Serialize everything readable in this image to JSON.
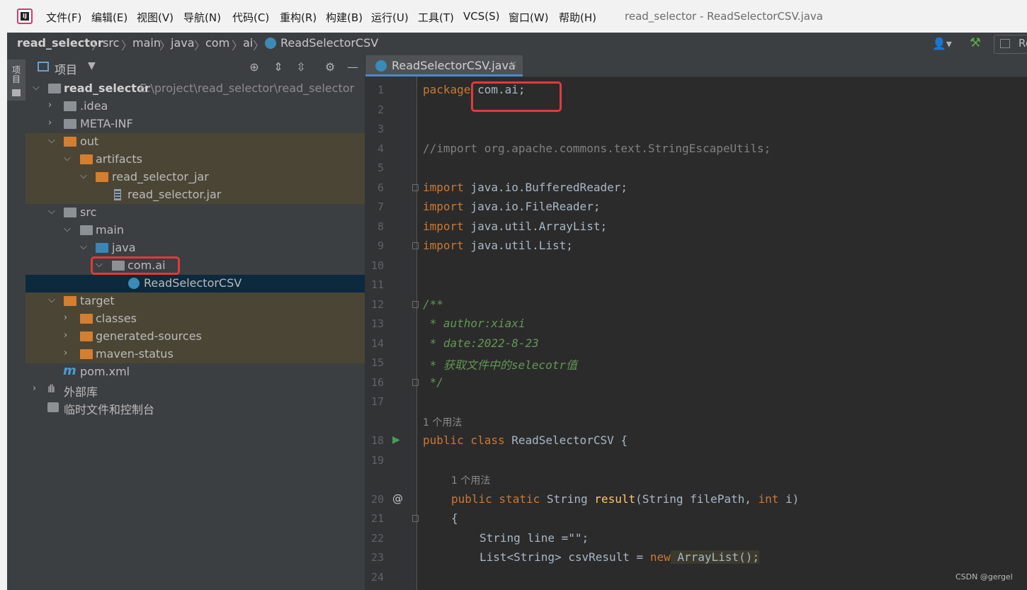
{
  "menu": {
    "items": [
      "文件(F)",
      "编辑(E)",
      "视图(V)",
      "导航(N)",
      "代码(C)",
      "重构(R)",
      "构建(B)",
      "运行(U)",
      "工具(T)",
      "VCS(S)",
      "窗口(W)",
      "帮助(H)"
    ],
    "window_title": "read_selector - ReadSelectorCSV.java"
  },
  "breadcrumb": [
    "read_selector",
    "src",
    "main",
    "java",
    "com",
    "ai",
    "ReadSelectorCSV"
  ],
  "toolbar": {
    "run_config_label": "Re"
  },
  "tool_window": {
    "vertical_label": "项目"
  },
  "project_panel": {
    "title": "项目",
    "tree": [
      {
        "label": "read_selector",
        "path": "E:\\project\\read_selector\\read_selector",
        "icon": "module-folder-icon"
      },
      {
        "label": ".idea",
        "icon": "folder-icon"
      },
      {
        "label": "META-INF",
        "icon": "folder-icon"
      },
      {
        "label": "out",
        "icon": "excluded-folder-icon"
      },
      {
        "label": "artifacts",
        "icon": "excluded-folder-icon"
      },
      {
        "label": "read_selector_jar",
        "icon": "excluded-folder-icon"
      },
      {
        "label": "read_selector.jar",
        "icon": "jar-file-icon"
      },
      {
        "label": "src",
        "icon": "folder-icon"
      },
      {
        "label": "main",
        "icon": "folder-icon"
      },
      {
        "label": "java",
        "icon": "source-root-icon"
      },
      {
        "label": "com.ai",
        "icon": "package-icon"
      },
      {
        "label": "ReadSelectorCSV",
        "icon": "java-class-icon"
      },
      {
        "label": "target",
        "icon": "excluded-folder-icon"
      },
      {
        "label": "classes",
        "icon": "excluded-folder-icon"
      },
      {
        "label": "generated-sources",
        "icon": "excluded-folder-icon"
      },
      {
        "label": "maven-status",
        "icon": "excluded-folder-icon"
      },
      {
        "label": "pom.xml",
        "icon": "maven-icon"
      },
      {
        "label": "外部库",
        "icon": "library-icon"
      },
      {
        "label": "临时文件和控制台",
        "icon": "scratches-icon"
      }
    ]
  },
  "editor": {
    "tab_label": "ReadSelectorCSV.java",
    "line_numbers": [
      "1",
      "2",
      "3",
      "4",
      "5",
      "6",
      "7",
      "8",
      "9",
      "10",
      "11",
      "12",
      "13",
      "14",
      "15",
      "16",
      "17",
      "18",
      "19",
      "20",
      "21",
      "22",
      "23",
      "24"
    ],
    "code": {
      "l1_kw": "package",
      "l1_rest": " com.ai;",
      "l4": "//import org.apache.commons.text.StringEscapeUtils;",
      "l6_kw": "import",
      "l6_rest": " java.io.BufferedReader;",
      "l7_kw": "import",
      "l7_rest": " java.io.FileReader;",
      "l8_kw": "import",
      "l8_rest": " java.util.ArrayList;",
      "l9_kw": "import",
      "l9_rest": " java.util.List;",
      "l12": "/**",
      "l13": " * author:xiaxi",
      "l14": " * date:2022-8-23",
      "l15": " * 获取文件中的selecotr值",
      "l16": " */",
      "hint1": "1 个用法",
      "l18_kw": "public class",
      "l18_rest": " ReadSelectorCSV {",
      "hint2": "1 个用法",
      "l20_kw": "public static",
      "l20_type": " String ",
      "l20_fn": "result",
      "l20_p1": "(String filePath, ",
      "l20_kw2": "int",
      "l20_p2": " i)",
      "l21": "{",
      "l22": "String line =\"\";",
      "l23_a": "List<String> csvResult = ",
      "l23_kw": "new",
      "l23_b": " ArrayList();"
    }
  },
  "watermark": "CSDN @gergel"
}
